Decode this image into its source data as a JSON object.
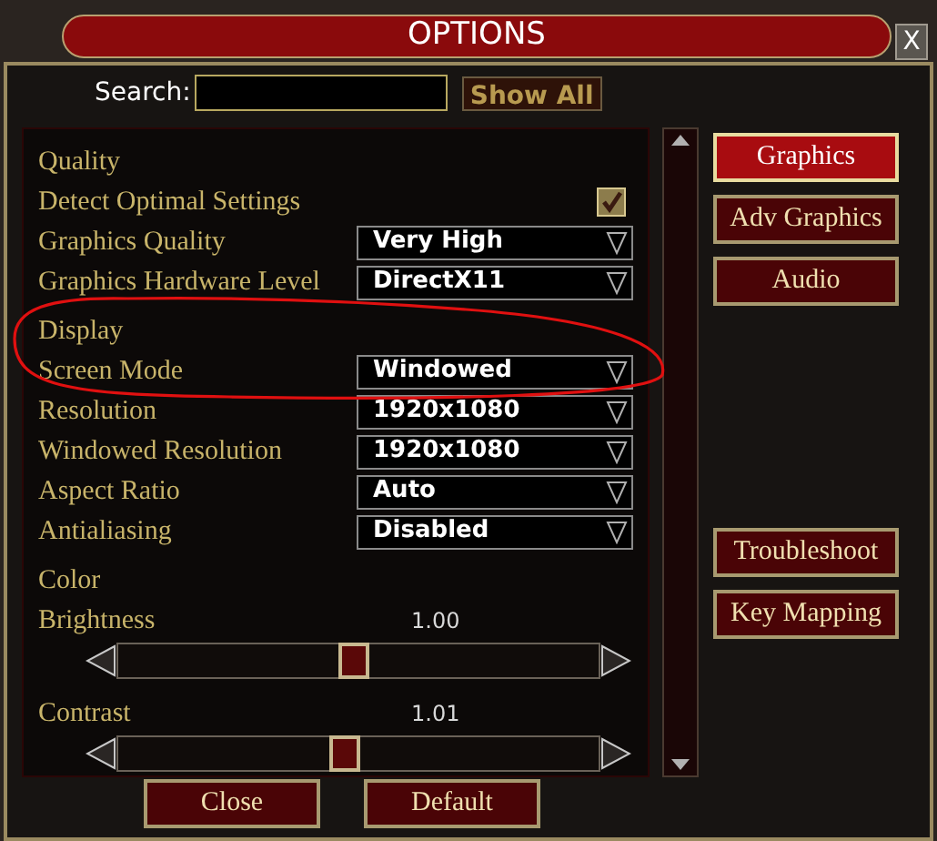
{
  "window": {
    "title": "OPTIONS",
    "close": "X"
  },
  "search": {
    "label": "Search:",
    "button": "Show All"
  },
  "settings": [
    {
      "kind": "heading",
      "label": "Quality"
    },
    {
      "kind": "checkbox",
      "label": "Detect Optimal Settings",
      "checked": true
    },
    {
      "kind": "dropdown",
      "label": "Graphics Quality",
      "value": "Very High"
    },
    {
      "kind": "dropdown",
      "label": "Graphics Hardware Level",
      "value": "DirectX11"
    },
    {
      "kind": "heading",
      "label": "Display"
    },
    {
      "kind": "dropdown",
      "label": "Screen Mode",
      "value": "Windowed"
    },
    {
      "kind": "dropdown",
      "label": "Resolution",
      "value": "1920x1080"
    },
    {
      "kind": "dropdown",
      "label": "Windowed Resolution",
      "value": "1920x1080"
    },
    {
      "kind": "dropdown",
      "label": "Aspect Ratio",
      "value": "Auto"
    },
    {
      "kind": "dropdown",
      "label": "Antialiasing",
      "value": "Disabled"
    },
    {
      "kind": "heading",
      "label": "Color"
    },
    {
      "kind": "slider",
      "label": "Brightness",
      "reading": "1.00",
      "level": 0.49
    },
    {
      "kind": "slider",
      "label": "Contrast",
      "reading": "1.01",
      "level": 0.47
    }
  ],
  "side_tabs": [
    {
      "label": "Graphics",
      "selected": true
    },
    {
      "label": "Adv Graphics",
      "selected": false
    },
    {
      "label": "Audio",
      "selected": false
    }
  ],
  "side_buttons": [
    "Troubleshoot",
    "Key Mapping"
  ],
  "footer_buttons": [
    "Close",
    "Default"
  ]
}
